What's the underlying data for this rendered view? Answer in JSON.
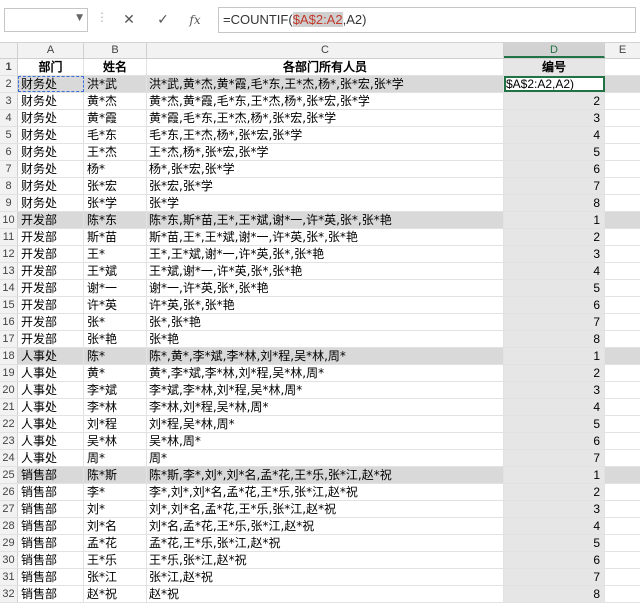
{
  "formula_bar": {
    "name_box": "",
    "dots": "⋮",
    "cancel_icon": "✕",
    "confirm_icon": "✓",
    "fx_label": "fx",
    "formula_prefix": "=COUNTIF(",
    "formula_ref": "$A$2:A2",
    "formula_suffix": ",A2)"
  },
  "columns": [
    "A",
    "B",
    "C",
    "D",
    "E"
  ],
  "header_row": {
    "num": "1",
    "a": "部门",
    "b": "姓名",
    "c": "各部门所有人员",
    "d": "编号",
    "e": ""
  },
  "active_cell_text": "$A$2:A2,A2)",
  "rows": [
    {
      "num": "2",
      "a": "财务处",
      "b": "洪*武",
      "c": "洪*武,黄*杰,黄*霞,毛*东,王*杰,杨*,张*宏,张*学",
      "d": ""
    },
    {
      "num": "3",
      "a": "财务处",
      "b": "黄*杰",
      "c": "黄*杰,黄*霞,毛*东,王*杰,杨*,张*宏,张*学",
      "d": "2"
    },
    {
      "num": "4",
      "a": "财务处",
      "b": "黄*霞",
      "c": "黄*霞,毛*东,王*杰,杨*,张*宏,张*学",
      "d": "3"
    },
    {
      "num": "5",
      "a": "财务处",
      "b": "毛*东",
      "c": "毛*东,王*杰,杨*,张*宏,张*学",
      "d": "4"
    },
    {
      "num": "6",
      "a": "财务处",
      "b": "王*杰",
      "c": "王*杰,杨*,张*宏,张*学",
      "d": "5"
    },
    {
      "num": "7",
      "a": "财务处",
      "b": "杨*",
      "c": "杨*,张*宏,张*学",
      "d": "6"
    },
    {
      "num": "8",
      "a": "财务处",
      "b": "张*宏",
      "c": "张*宏,张*学",
      "d": "7"
    },
    {
      "num": "9",
      "a": "财务处",
      "b": "张*学",
      "c": "张*学",
      "d": "8"
    },
    {
      "num": "10",
      "a": "开发部",
      "b": "陈*东",
      "c": "陈*东,斯*苗,王*,王*斌,谢*一,许*英,张*,张*艳",
      "d": "1"
    },
    {
      "num": "11",
      "a": "开发部",
      "b": "斯*苗",
      "c": "斯*苗,王*,王*斌,谢*一,许*英,张*,张*艳",
      "d": "2"
    },
    {
      "num": "12",
      "a": "开发部",
      "b": "王*",
      "c": "王*,王*斌,谢*一,许*英,张*,张*艳",
      "d": "3"
    },
    {
      "num": "13",
      "a": "开发部",
      "b": "王*斌",
      "c": "王*斌,谢*一,许*英,张*,张*艳",
      "d": "4"
    },
    {
      "num": "14",
      "a": "开发部",
      "b": "谢*一",
      "c": "谢*一,许*英,张*,张*艳",
      "d": "5"
    },
    {
      "num": "15",
      "a": "开发部",
      "b": "许*英",
      "c": "许*英,张*,张*艳",
      "d": "6"
    },
    {
      "num": "16",
      "a": "开发部",
      "b": "张*",
      "c": "张*,张*艳",
      "d": "7"
    },
    {
      "num": "17",
      "a": "开发部",
      "b": "张*艳",
      "c": "张*艳",
      "d": "8"
    },
    {
      "num": "18",
      "a": "人事处",
      "b": "陈*",
      "c": "陈*,黄*,李*斌,李*林,刘*程,吴*林,周*",
      "d": "1"
    },
    {
      "num": "19",
      "a": "人事处",
      "b": "黄*",
      "c": "黄*,李*斌,李*林,刘*程,吴*林,周*",
      "d": "2"
    },
    {
      "num": "20",
      "a": "人事处",
      "b": "李*斌",
      "c": "李*斌,李*林,刘*程,吴*林,周*",
      "d": "3"
    },
    {
      "num": "21",
      "a": "人事处",
      "b": "李*林",
      "c": "李*林,刘*程,吴*林,周*",
      "d": "4"
    },
    {
      "num": "22",
      "a": "人事处",
      "b": "刘*程",
      "c": "刘*程,吴*林,周*",
      "d": "5"
    },
    {
      "num": "23",
      "a": "人事处",
      "b": "吴*林",
      "c": "吴*林,周*",
      "d": "6"
    },
    {
      "num": "24",
      "a": "人事处",
      "b": "周*",
      "c": "周*",
      "d": "7"
    },
    {
      "num": "25",
      "a": "销售部",
      "b": "陈*斯",
      "c": "陈*斯,李*,刘*,刘*名,孟*花,王*乐,张*江,赵*祝",
      "d": "1"
    },
    {
      "num": "26",
      "a": "销售部",
      "b": "李*",
      "c": "李*,刘*,刘*名,孟*花,王*乐,张*江,赵*祝",
      "d": "2"
    },
    {
      "num": "27",
      "a": "销售部",
      "b": "刘*",
      "c": "刘*,刘*名,孟*花,王*乐,张*江,赵*祝",
      "d": "3"
    },
    {
      "num": "28",
      "a": "销售部",
      "b": "刘*名",
      "c": "刘*名,孟*花,王*乐,张*江,赵*祝",
      "d": "4"
    },
    {
      "num": "29",
      "a": "销售部",
      "b": "孟*花",
      "c": "孟*花,王*乐,张*江,赵*祝",
      "d": "5"
    },
    {
      "num": "30",
      "a": "销售部",
      "b": "王*乐",
      "c": "王*乐,张*江,赵*祝",
      "d": "6"
    },
    {
      "num": "31",
      "a": "销售部",
      "b": "张*江",
      "c": "张*江,赵*祝",
      "d": "7"
    },
    {
      "num": "32",
      "a": "销售部",
      "b": "赵*祝",
      "c": "赵*祝",
      "d": "8"
    }
  ],
  "band_rows": [
    "2",
    "10",
    "18",
    "25"
  ]
}
